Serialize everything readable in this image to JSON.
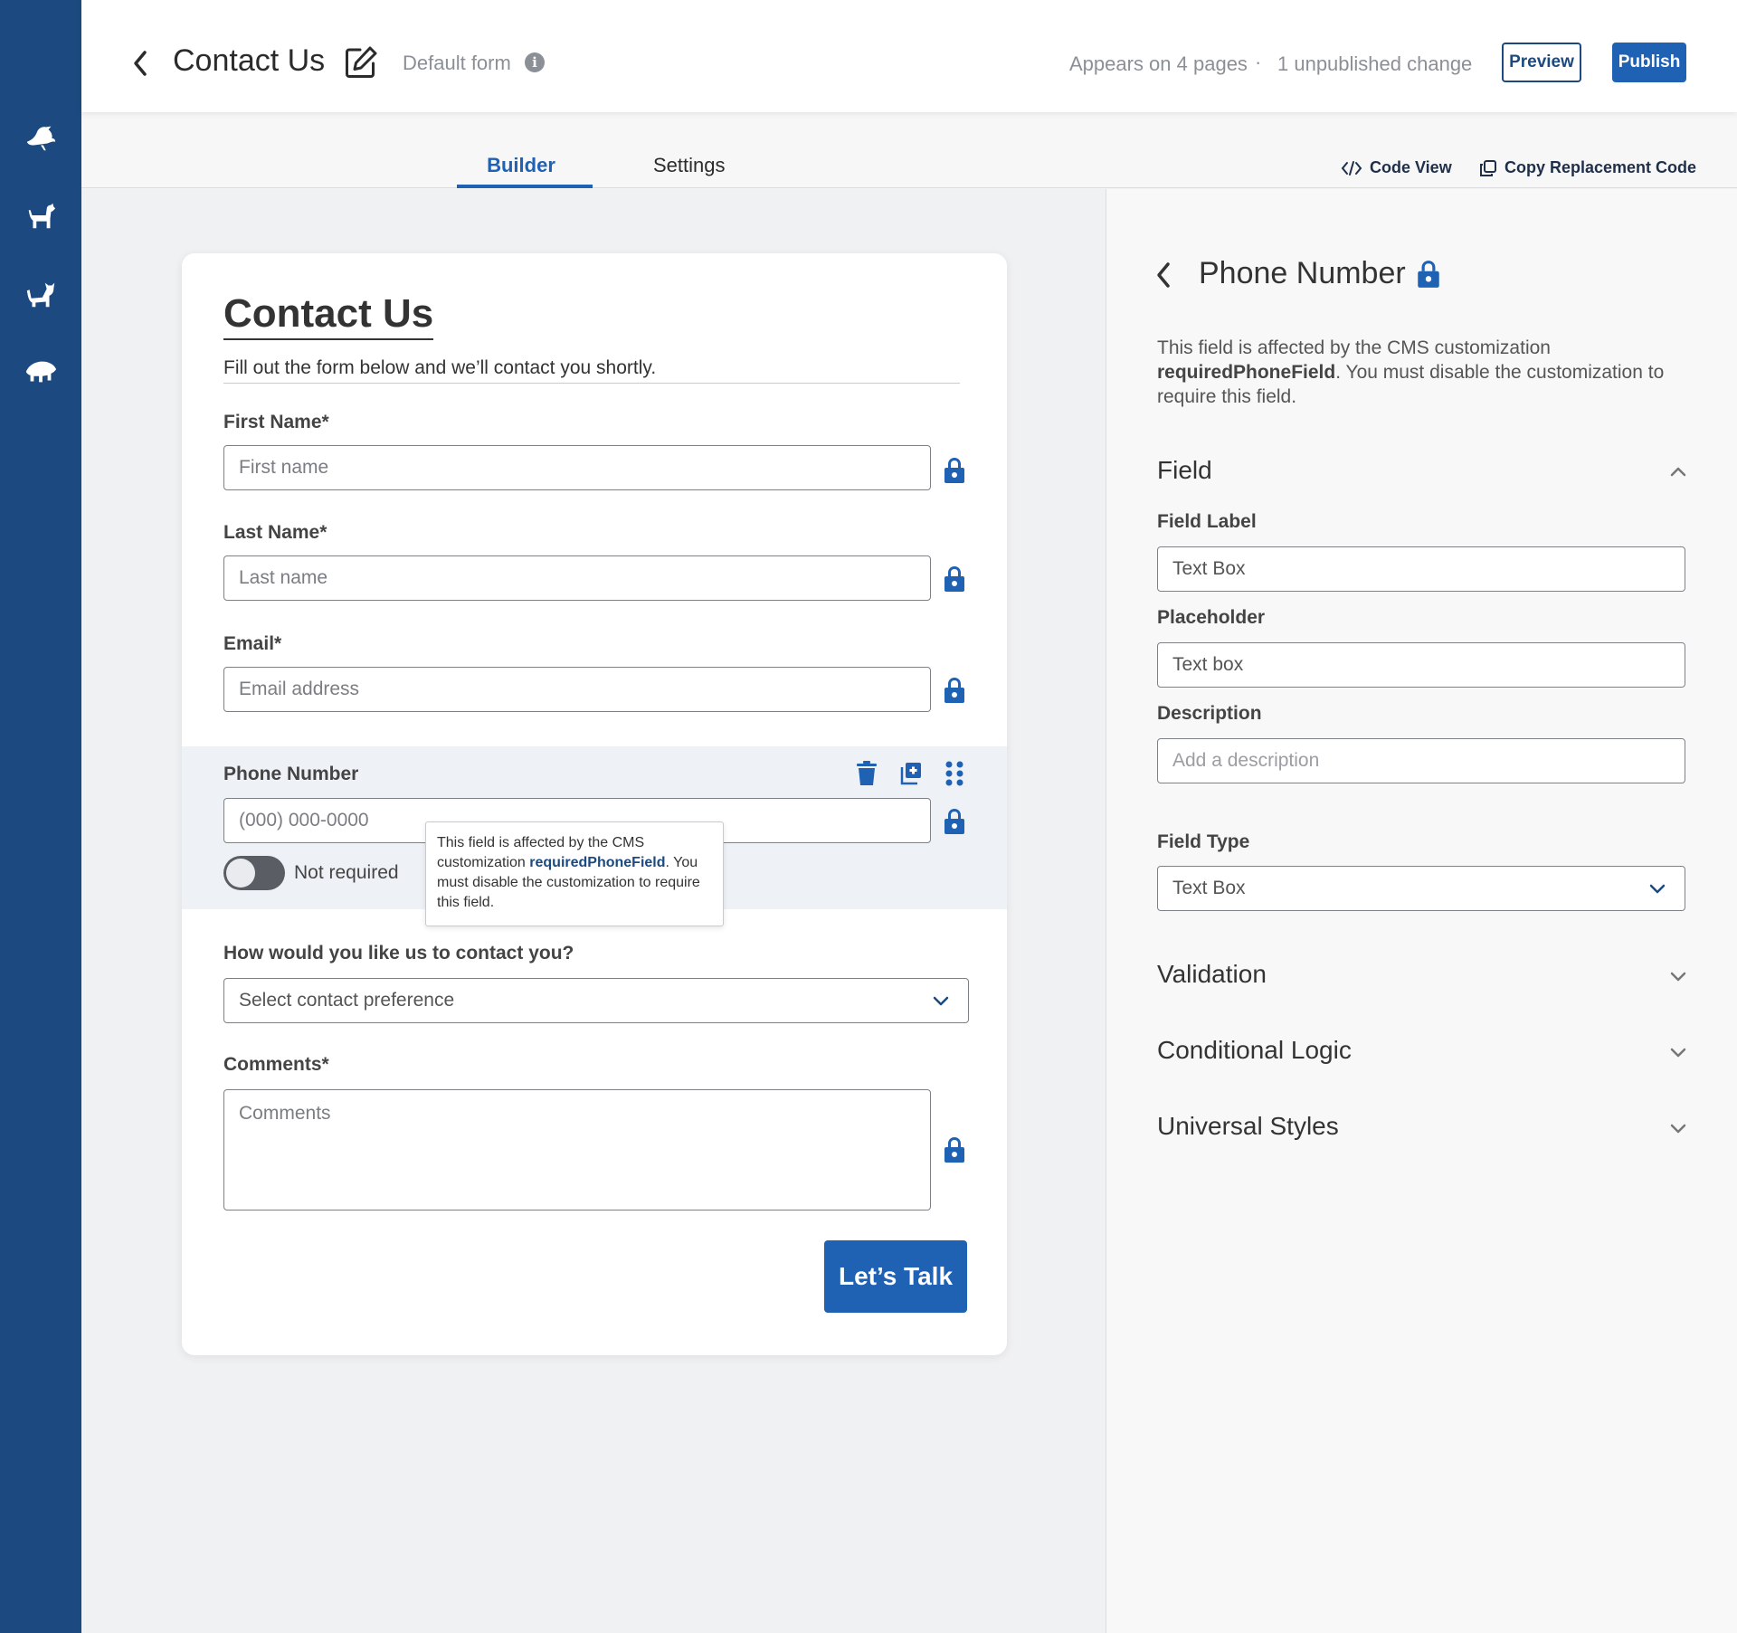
{
  "rail": {
    "icons": [
      "bird-icon",
      "dog-icon",
      "cat-icon",
      "fish-icon"
    ]
  },
  "header": {
    "title": "Contact Us",
    "form_type": "Default form",
    "appears": "Appears on 4 pages",
    "separator": "·",
    "unpublished": "1 unpublished change",
    "preview_label": "Preview",
    "publish_label": "Publish"
  },
  "tabs": {
    "builder": "Builder",
    "settings": "Settings",
    "code_view": "Code View",
    "copy_code": "Copy Replacement Code"
  },
  "form": {
    "title": "Contact Us",
    "subtitle": "Fill out the form below and we’ll contact you shortly.",
    "first_name": {
      "label": "First Name*",
      "placeholder": "First name"
    },
    "last_name": {
      "label": "Last Name*",
      "placeholder": "Last name"
    },
    "email": {
      "label": "Email*",
      "placeholder": "Email address"
    },
    "phone": {
      "label": "Phone Number",
      "placeholder": "(000) 000-0000",
      "toggle_label": "Not required"
    },
    "tooltip": {
      "text_1": "This field is affected by the CMS customization ",
      "highlight": "requiredPhoneField",
      "text_2": ". You must disable the customization to require this field."
    },
    "contact_pref": {
      "label": "How would you like us to contact you?",
      "value": "Select contact preference"
    },
    "comments": {
      "label": "Comments*",
      "placeholder": "Comments"
    },
    "submit_label": "Let’s Talk"
  },
  "panel": {
    "title": "Phone Number",
    "note_1": "This field is affected by the CMS customization ",
    "note_bold": "requiredPhoneField",
    "note_2": ". You must disable the customization to require this field.",
    "field_section": "Field",
    "field_label_label": "Field Label",
    "field_label_value": "Text Box",
    "placeholder_label": "Placeholder",
    "placeholder_value": "Text box",
    "description_label": "Description",
    "description_placeholder": "Add a description",
    "field_type_label": "Field Type",
    "field_type_value": "Text Box",
    "validation": "Validation",
    "conditional_logic": "Conditional Logic",
    "universal_styles": "Universal Styles"
  },
  "colors": {
    "rail": "#1c4a80",
    "accent": "#1f61b3"
  }
}
